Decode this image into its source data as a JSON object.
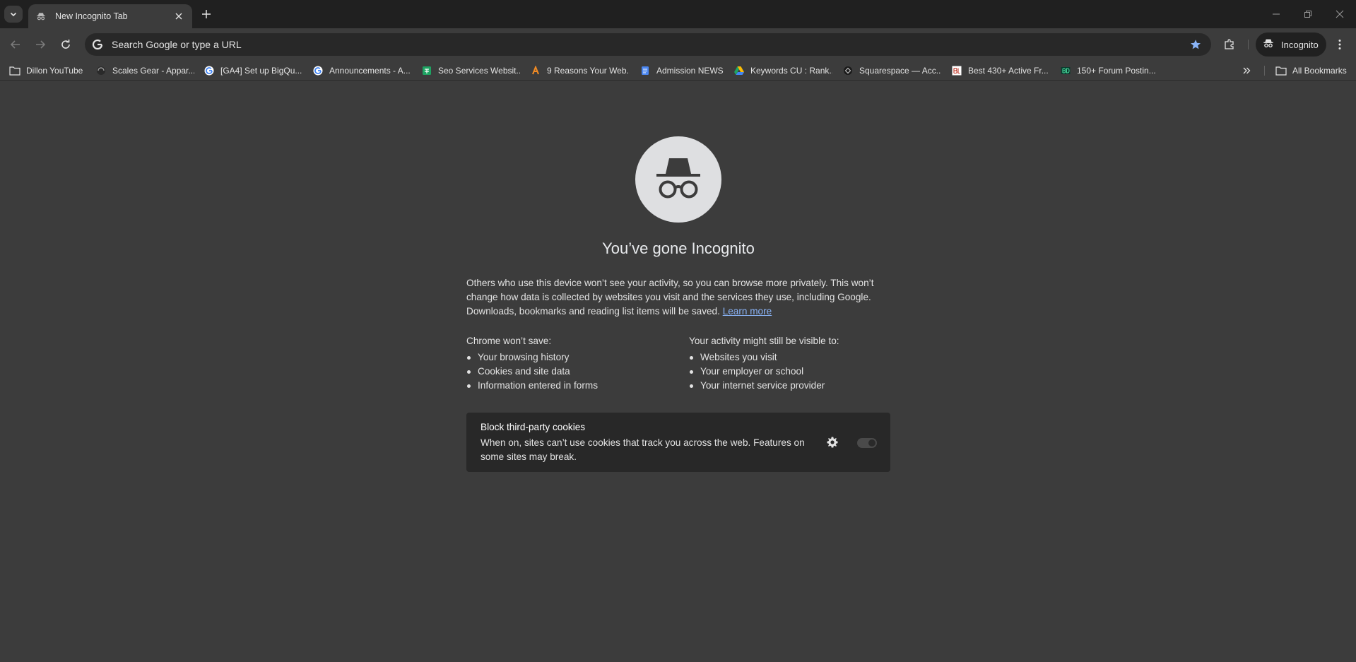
{
  "tabstrip": {
    "tab_title": "New Incognito Tab",
    "icons": {
      "tab_search": "chevron-down-icon",
      "tab_favicon": "incognito-icon",
      "close": "close-icon",
      "new_tab": "plus-icon",
      "minimize": "minimize-icon",
      "restore": "restore-icon",
      "window_close": "window-close-icon"
    }
  },
  "toolbar": {
    "omnibox_placeholder": "Search Google or type a URL",
    "profile_label": "Incognito",
    "icons": {
      "back": "arrow-left-icon",
      "forward": "arrow-right-icon",
      "reload": "reload-icon",
      "google": "google-g-icon",
      "bookmark_star": "star-icon",
      "extensions": "puzzle-icon",
      "menu": "kebab-menu-icon"
    },
    "star_color": "#8ab4f8"
  },
  "bookmarks": {
    "items": [
      {
        "label": "Dillon YouTube",
        "icon": "folder-icon"
      },
      {
        "label": "Scales Gear - Appar...",
        "icon": "scales-icon"
      },
      {
        "label": "[GA4] Set up BigQu...",
        "icon": "google-g-icon"
      },
      {
        "label": "Announcements - A...",
        "icon": "google-g-icon"
      },
      {
        "label": "Seo Services Websit...",
        "icon": "sheets-icon"
      },
      {
        "label": "9 Reasons Your Web...",
        "icon": "a-letter-icon"
      },
      {
        "label": "Admission NEWS",
        "icon": "docs-icon"
      },
      {
        "label": "Keywords CU : Rank...",
        "icon": "drive-icon"
      },
      {
        "label": "Squarespace — Acc...",
        "icon": "squarespace-icon"
      },
      {
        "label": "Best 430+ Active Fr...",
        "icon": "bl-icon"
      },
      {
        "label": "150+ Forum Postin...",
        "icon": "bd-icon"
      }
    ],
    "all_bookmarks_label": "All Bookmarks",
    "icons": {
      "more": "double-chevron-right-icon",
      "all_folder": "folder-icon"
    }
  },
  "ntp": {
    "title": "You’ve gone Incognito",
    "lead": "Others who use this device won’t see your activity, so you can browse more privately. This won’t change how data is collected by websites you visit and the services they use, including Google. Downloads, bookmarks and reading list items will be saved.",
    "learn_more": "Learn more",
    "wont_save_head": "Chrome won’t save:",
    "wont_save": [
      "Your browsing history",
      "Cookies and site data",
      "Information entered in forms"
    ],
    "visible_head": "Your activity might still be visible to:",
    "visible": [
      "Websites you visit",
      "Your employer or school",
      "Your internet service provider"
    ],
    "cookie_title": "Block third-party cookies",
    "cookie_desc": "When on, sites can’t use cookies that track you across the web. Features on some sites may break.",
    "cookie_toggle_on": false,
    "icons": {
      "hero": "incognito-icon",
      "settings": "gear-icon"
    }
  }
}
